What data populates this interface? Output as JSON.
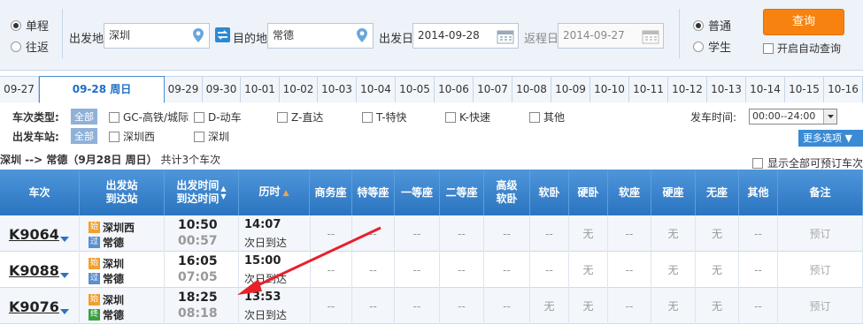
{
  "search": {
    "trip_types": [
      {
        "label": "单程",
        "checked": true
      },
      {
        "label": "往返",
        "checked": false
      }
    ],
    "from_label": "出发地",
    "from_value": "深圳",
    "to_label": "目的地",
    "to_value": "常德",
    "depart_label": "出发日",
    "depart_value": "2014-09-28",
    "return_label": "返程日",
    "return_value": "2014-09-27",
    "passenger_types": [
      {
        "label": "普通",
        "checked": true
      },
      {
        "label": "学生",
        "checked": false
      }
    ],
    "search_button": "查询",
    "auto_query_label": "开启自动查询"
  },
  "dates": [
    "09-27",
    "09-28  周日",
    "09-29",
    "09-30",
    "10-01",
    "10-02",
    "10-03",
    "10-04",
    "10-05",
    "10-06",
    "10-07",
    "10-08",
    "10-09",
    "10-10",
    "10-11",
    "10-12",
    "10-13",
    "10-14",
    "10-15",
    "10-16"
  ],
  "active_date_index": 1,
  "filters": {
    "type_label": "车次类型:",
    "all_label": "全部",
    "types": [
      "GC-高铁/城际",
      "D-动车",
      "Z-直达",
      "T-特快",
      "K-快速",
      "其他"
    ],
    "station_label": "出发车站:",
    "stations": [
      "深圳西",
      "深圳"
    ],
    "time_label": "发车时间:",
    "time_value": "00:00--24:00",
    "more_label": "更多选项"
  },
  "summary": {
    "route": "深圳 --> 常德（9月28日  周日）",
    "count": "共计3个车次",
    "show_all": "显示全部可预订车次"
  },
  "headers": {
    "train": "车次",
    "station_top": "出发站",
    "station_bottom": "到达站",
    "time_top": "出发时间",
    "time_bottom": "到达时间",
    "duration": "历时",
    "seats": [
      "商务座",
      "特等座",
      "一等座",
      "二等座",
      "高级\n软卧",
      "软卧",
      "硬卧",
      "软座",
      "硬座",
      "无座",
      "其他"
    ],
    "note": "备注"
  },
  "rows": [
    {
      "train": "K9064",
      "from_badge": "始",
      "from": "深圳西",
      "to_badge": "过",
      "to": "常德",
      "depart": "10:50",
      "arrive": "00:57",
      "duration": "14:07",
      "duration_note": "次日到达",
      "seats": [
        "--",
        "--",
        "--",
        "--",
        "--",
        "--",
        "无",
        "--",
        "无",
        "无",
        "--"
      ],
      "note": "预订"
    },
    {
      "train": "K9088",
      "from_badge": "始",
      "from": "深圳",
      "to_badge": "过",
      "to": "常德",
      "depart": "16:05",
      "arrive": "07:05",
      "duration": "15:00",
      "duration_note": "次日到达",
      "seats": [
        "--",
        "--",
        "--",
        "--",
        "--",
        "--",
        "无",
        "--",
        "无",
        "无",
        "--"
      ],
      "note": "预订"
    },
    {
      "train": "K9076",
      "from_badge": "始",
      "from": "深圳",
      "to_badge": "终",
      "to": "常德",
      "depart": "18:25",
      "arrive": "08:18",
      "duration": "13:53",
      "duration_note": "次日到达",
      "seats": [
        "--",
        "--",
        "--",
        "--",
        "--",
        "无",
        "无",
        "--",
        "无",
        "无",
        "--"
      ],
      "note": "预订"
    }
  ],
  "colors": {
    "accent": "#2a74c0",
    "search_button": "#f7820f",
    "badge_start": "#f0a030",
    "badge_pass": "#5a8fd0",
    "badge_end": "#3aa040",
    "annotation_arrow": "#e8202a"
  }
}
